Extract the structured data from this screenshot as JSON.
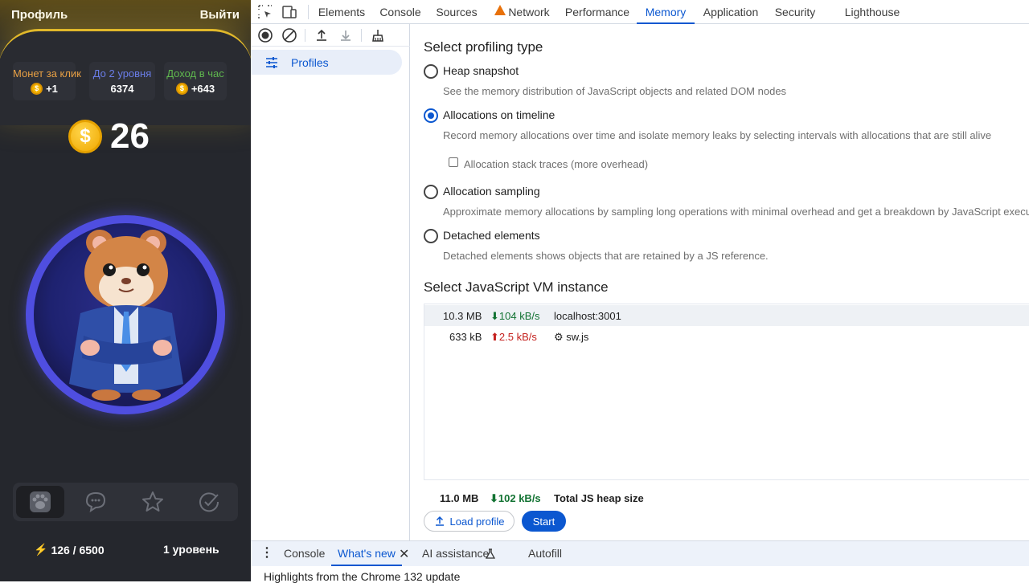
{
  "app": {
    "profile_label": "Профиль",
    "logout_label": "Выйти",
    "stats": [
      {
        "label": "Монет за клик",
        "value": "+1",
        "coin": true
      },
      {
        "label": "До 2 уровня",
        "value": "6374",
        "coin": false
      },
      {
        "label": "Доход в час",
        "value": "+643",
        "coin": true
      }
    ],
    "balance": "26",
    "coin_symbol": "$",
    "nav": [
      "paw-icon",
      "chat-icon",
      "star-icon",
      "check-icon"
    ],
    "energy": "126 / 6500",
    "level": "1 уровень",
    "colors": {
      "accent": "#e0b82a",
      "ring": "#4f4ee0"
    }
  },
  "devtools": {
    "tabs": [
      "Elements",
      "Console",
      "Sources",
      "Network",
      "Performance",
      "Memory",
      "Application",
      "Security",
      "Lighthouse"
    ],
    "active_tab": "Memory",
    "sidebar": {
      "profiles_label": "Profiles"
    },
    "profiling": {
      "heading": "Select profiling type",
      "options": [
        {
          "title": "Heap snapshot",
          "desc": "See the memory distribution of JavaScript objects and related DOM nodes",
          "checked": false
        },
        {
          "title": "Allocations on timeline",
          "desc": "Record memory allocations over time and isolate memory leaks by selecting intervals with allocations that are still alive",
          "checked": true
        },
        {
          "title": "Allocation sampling",
          "desc": "Approximate memory allocations by sampling long operations with minimal overhead and get a breakdown by JavaScript execu",
          "checked": false
        },
        {
          "title": "Detached elements",
          "desc": "Detached elements shows objects that are retained by a JS reference.",
          "checked": false
        }
      ],
      "stack_traces_label": "Allocation stack traces (more overhead)"
    },
    "vm": {
      "heading": "Select JavaScript VM instance",
      "rows": [
        {
          "size": "10.3 MB",
          "rate": "⬇104 kB/s",
          "rate_dir": "down",
          "name": "localhost:3001"
        },
        {
          "size": "633 kB",
          "rate": "⬆2.5 kB/s",
          "rate_dir": "up",
          "name": "⚙ sw.js"
        }
      ],
      "total_size": "11.0 MB",
      "total_rate": "⬇102 kB/s",
      "total_label": "Total JS heap size"
    },
    "buttons": {
      "load": "Load profile",
      "start": "Start"
    },
    "drawer": {
      "tabs": [
        "Console",
        "What's new",
        "AI assistance",
        "Autofill"
      ],
      "active": "What's new",
      "highlights": "Highlights from the Chrome 132 update"
    }
  }
}
